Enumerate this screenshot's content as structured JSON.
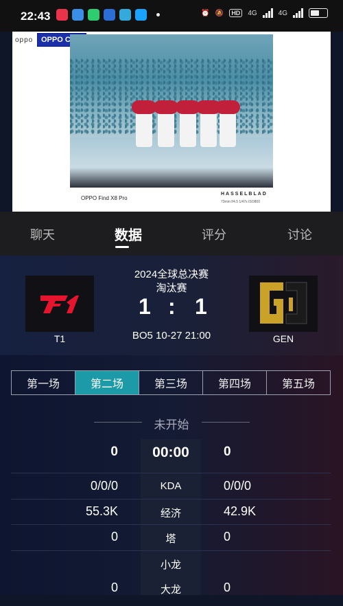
{
  "statusbar": {
    "time": "22:43",
    "hd_badge": "HD",
    "net1": "4G",
    "net2": "4G",
    "app_colors": [
      "#e8334a",
      "#3a8ee6",
      "#2ecc71",
      "#2b6fd6",
      "#34aadc",
      "#1aa2ff"
    ]
  },
  "photo": {
    "brand_small": "oppo",
    "cam_badge": "OPPO CAM",
    "caption_model": "OPPO Find X8 Pro",
    "caption_brand": "HASSELBLAD",
    "caption_spec": "73mm f/4.5 1/47s ISO800"
  },
  "tabs": [
    {
      "label": "聊天"
    },
    {
      "label": "数据"
    },
    {
      "label": "评分"
    },
    {
      "label": "讨论"
    }
  ],
  "match": {
    "competition": "2024全球总决赛",
    "stage": "淘汰赛",
    "team_left": "T1",
    "team_right": "GEN",
    "score_left": "1",
    "score_sep": ":",
    "score_right": "1",
    "bo_time": "BO5 10-27 21:00",
    "accent_t1": "#e5152e",
    "accent_gen": "#c9a227"
  },
  "games": [
    {
      "label": "第一场"
    },
    {
      "label": "第二场"
    },
    {
      "label": "第三场"
    },
    {
      "label": "第四场"
    },
    {
      "label": "第五场"
    }
  ],
  "game_status": "未开始",
  "stats": [
    {
      "left": "0",
      "label": "00:00",
      "right": "0"
    },
    {
      "left": "0/0/0",
      "label": "KDA",
      "right": "0/0/0"
    },
    {
      "left": "55.3K",
      "label": "经济",
      "right": "42.9K"
    },
    {
      "left": "0",
      "label": "塔",
      "right": "0"
    },
    {
      "left": "",
      "label": "小龙",
      "right": ""
    },
    {
      "left": "0",
      "label": "大龙",
      "right": "0"
    }
  ]
}
